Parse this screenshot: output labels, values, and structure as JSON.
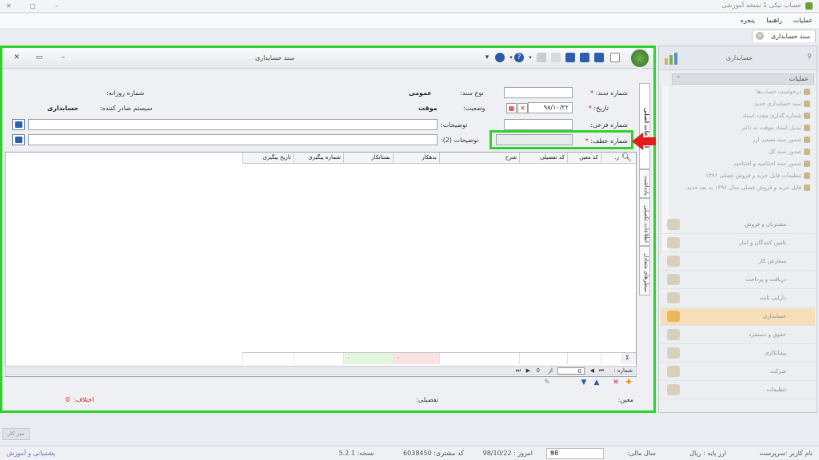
{
  "app": {
    "title": "حساب نیکی 1 نسخه آموزشی",
    "menu": [
      "عملیات",
      "راهنما",
      "پنجره"
    ]
  },
  "doc_tab": {
    "label": "سند حسابداری"
  },
  "window": {
    "title": "سند حسابداری"
  },
  "vertical_tabs": [
    "اطلاعات اصلی",
    "یادداشت",
    "اطلاعات تکمیلی",
    "سطرهای متعادل"
  ],
  "form": {
    "doc_number_label": "شماره سند:",
    "doc_type_label": "نوع سند:",
    "doc_type_value": "عمومی",
    "daily_number_label": "شماره روزانه:",
    "date_label": "تاریخ:",
    "date_value": "۹۸/۱۰/۲۲",
    "status_label": "وضعیت:",
    "status_value": "موقت",
    "issuer_label": "سیستم صادر کننده:",
    "issuer_value": "حسابداری",
    "sub_number_label": "شماره فرعی:",
    "desc_label": "توضیحات:",
    "desc2_label": "توضیحات (2):",
    "ref_number_label": "شماره عطف:"
  },
  "grid": {
    "columns": [
      "ر.",
      "کد معین",
      "کد تفصیلی",
      "شرح",
      "بدهکار",
      "بستانکار",
      "شماره پیگیری",
      "تاریخ پیگیری"
    ],
    "footer": {
      "sigma": "Σ",
      "debit_total": "۰",
      "credit_total": "۰"
    },
    "pager": {
      "label": "شماره :",
      "current": "0",
      "of_label": "از",
      "total": "0"
    }
  },
  "doc_status": {
    "moein_label": "معین:",
    "tafsili_label": "تفصیلی:",
    "diff_label": "اختلاف:",
    "diff_value": "0"
  },
  "nav": {
    "header": "حسابداری",
    "ops_header": "عملیات",
    "ops": [
      "درخواست حساب‌ها",
      "سند حسابداری جدید",
      "شماره گذاری مجدد اسناد",
      "تبدیل اسناد موقت به دائم",
      "صدور سند تسعیر ارز",
      "صدور سند کل",
      "صدور سند اختتامیه و افتتاحیه",
      "تنظیمات فایل خرید و فروش فصلی ۱۳۹۶",
      "فایل خرید و فروش فصلی سال ۱۳۹۶ به بعد جدید"
    ],
    "items": [
      "مشتریان و فروش",
      "تامین کنندگان و انبار",
      "سفارش کار",
      "دریافت و پرداخت",
      "دارایی ثابت",
      "حسابداری",
      "حقوق و دستمزد",
      "پیمانکاری",
      "شرکت",
      "تنظیمات"
    ],
    "active_item": "حسابداری"
  },
  "taskbar": {
    "chip": "میز کار"
  },
  "status_bar": {
    "user": "نام کاربر :سرپرست",
    "currency": "ارز پایه : ریال",
    "fiscal_year_label": "سال مالی:",
    "fiscal_year_value": "98",
    "today": "امروز : 98/10/22",
    "customer_code": "کد مشتری: 6038450",
    "version": "نسخه: 5.2.1",
    "support": "پشتیبانی و آموزش"
  },
  "colors": {
    "highlight": "#2fd12f",
    "arrow": "#e21b1b",
    "active_nav": "#f6dfb8",
    "required": "#d11111"
  }
}
